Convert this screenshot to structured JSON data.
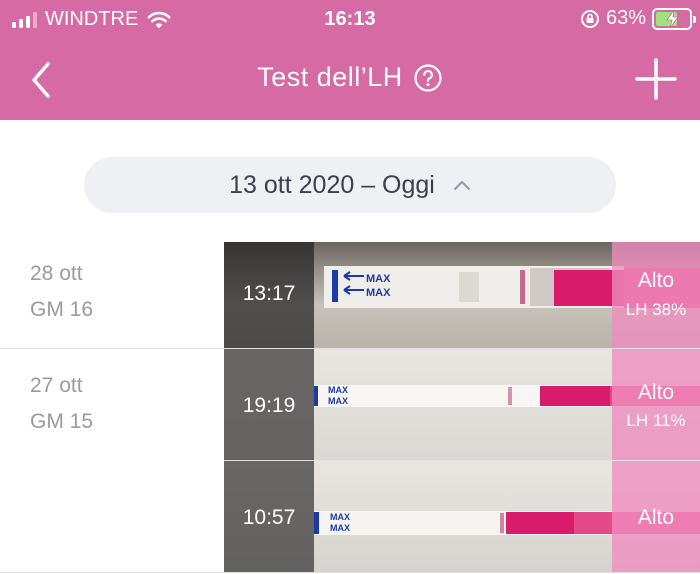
{
  "status_bar": {
    "carrier": "WINDTRE",
    "time": "16:13",
    "battery": "63%",
    "colors": {
      "battery_fill": "#9be37a"
    }
  },
  "nav": {
    "title": "Test dell’LH",
    "back_icon": "chevron-left-icon",
    "help_icon": "help-circle-icon",
    "add_icon": "plus-icon"
  },
  "range": {
    "label": "13 ott 2020 – Oggi",
    "icon": "chevron-up-icon"
  },
  "entries": [
    {
      "date": "28 ott",
      "cycle_day": "GM 16",
      "tests": [
        {
          "time": "13:17",
          "result": "Alto",
          "lh": "LH 38%"
        }
      ]
    },
    {
      "date": "27 ott",
      "cycle_day": "GM 15",
      "tests": [
        {
          "time": "19:19",
          "result": "Alto",
          "lh": "LH 11%"
        },
        {
          "time": "10:57",
          "result": "Alto",
          "lh": ""
        }
      ]
    }
  ],
  "strip_label": "MAX",
  "colors": {
    "header": "#d66aa4",
    "range_bg": "#eef0f4",
    "result_overlay": "#f08cbe",
    "strip_pink": "#d81b6a",
    "max_blue": "#1b3aa8"
  }
}
